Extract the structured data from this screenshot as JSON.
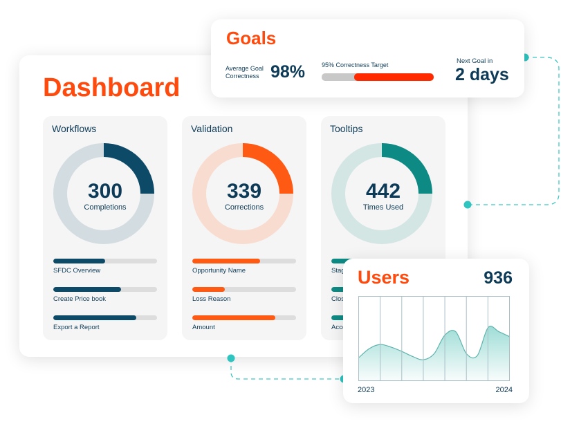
{
  "colors": {
    "accent": "#ff4a0e",
    "navy": "#0d3b57",
    "teal": "#0e8a84",
    "orange": "#ff5a14"
  },
  "dashboard": {
    "title": "Dashboard",
    "panels": [
      {
        "title": "Workflows",
        "value": "300",
        "label": "Completions",
        "progress": 0.25,
        "color": "#0d4a68",
        "track": "#d3dde1",
        "items": [
          {
            "label": "SFDC Overview",
            "progress": 0.5
          },
          {
            "label": "Create Price book",
            "progress": 0.65
          },
          {
            "label": "Export a Report",
            "progress": 0.8
          }
        ]
      },
      {
        "title": "Validation",
        "value": "339",
        "label": "Corrections",
        "progress": 0.25,
        "color": "#ff5a14",
        "track": "#f8dcd0",
        "items": [
          {
            "label": "Opportunity Name",
            "progress": 0.65
          },
          {
            "label": "Loss Reason",
            "progress": 0.31
          },
          {
            "label": "Amount",
            "progress": 0.8
          }
        ]
      },
      {
        "title": "Tooltips",
        "value": "442",
        "label": "Times Used",
        "progress": 0.25,
        "color": "#0e8a84",
        "track": "#d3e6e4",
        "items": [
          {
            "label": "Stage",
            "progress": 0.65
          },
          {
            "label": "Close Date",
            "progress": 0.45
          },
          {
            "label": "Account",
            "progress": 0.3
          }
        ]
      }
    ]
  },
  "goals": {
    "title": "Goals",
    "avg_label": "Average Goal Correctness",
    "avg_value": "98%",
    "target_label": "95% Correctness Target",
    "target_progress": 0.71,
    "next_label": "Next Goal in",
    "next_value": "2 days"
  },
  "users": {
    "title": "Users",
    "count": "936",
    "chart_data": {
      "type": "area",
      "x_labels": [
        "2023",
        "2024"
      ],
      "values": [
        27,
        38,
        43,
        40,
        35,
        29,
        25,
        32,
        54,
        58,
        32,
        30,
        63,
        58,
        52
      ],
      "ylim": [
        0,
        100
      ],
      "grid": "vertical",
      "color": "#7fd1c9"
    }
  }
}
